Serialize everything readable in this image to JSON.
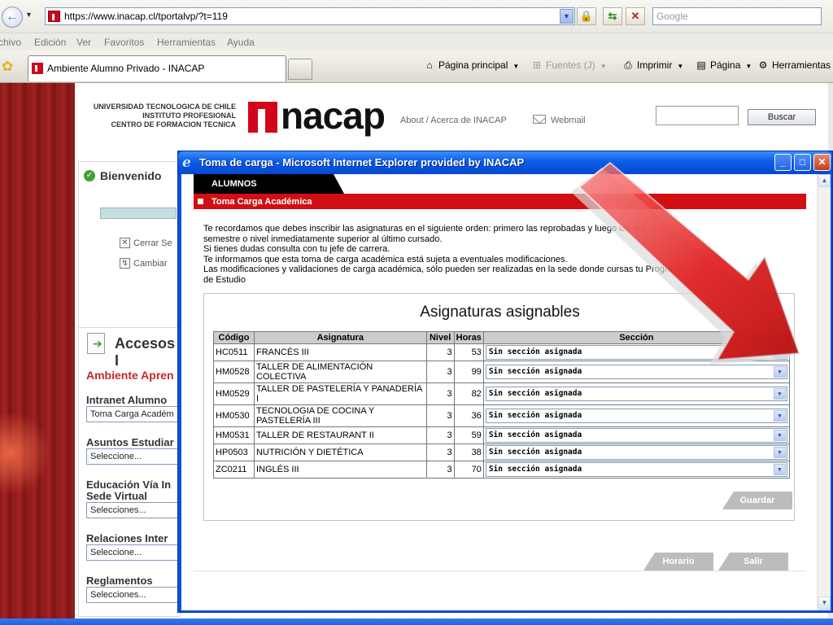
{
  "browser": {
    "url": "https://www.inacap.cl/tportalvp/?t=119",
    "search_placeholder": "Google",
    "menu": [
      "chivo",
      "Edición",
      "Ver",
      "Favoritos",
      "Herramientas",
      "Ayuda"
    ],
    "tab_title": "Ambiente Alumno Privado - INACAP",
    "commands": {
      "home": "Página principal",
      "feeds": "Fuentes (J)",
      "print": "Imprimir",
      "page": "Página",
      "tools": "Herramientas"
    }
  },
  "site": {
    "university_lines": [
      "UNIVERSIDAD TECNOLOGICA DE CHILE",
      "INSTITUTO PROFESIONAL",
      "CENTRO DE FORMACION TECNICA"
    ],
    "logo_text": "nacap",
    "about_link": "About / Acerca de INACAP",
    "webmail_link": "Webmail",
    "search_button": "Buscar",
    "welcome": {
      "title": "Bienvenido",
      "links": [
        "Cerrar Se",
        "Cambiar"
      ]
    },
    "accesos": {
      "title": "Accesos I",
      "ambiente": "Ambiente Apren",
      "sections": [
        {
          "label": "Intranet Alumno",
          "select": "Toma Carga Académ"
        },
        {
          "label": "Asuntos Estudiar",
          "select": "Seleccione..."
        },
        {
          "label": "Educación Vía In\nSede Virtual",
          "select": "Selecciones..."
        },
        {
          "label": "Relaciones Inter",
          "select": "Seleccione..."
        },
        {
          "label": "Reglamentos",
          "select": "Selecciones..."
        }
      ]
    }
  },
  "popup": {
    "title": "Toma de carga - Microsoft Internet Explorer provided by INACAP",
    "tab_label": "ALUMNOS",
    "section_label": "Toma Carga Académica",
    "instructions": [
      "Te recordamos que debes inscribir las asignaturas en el siguiente orden: primero las reprobadas y luego las del",
      "semestre o nivel inmediatamente superior al último cursado.",
      "Si tienes dudas consulta con tu jefe de carrera.",
      "Te informamos que esta toma de carga académica está sujeta a eventuales modificaciones.",
      "Las modificaciones y validaciones de carga académica, sólo pueden ser realizadas en la sede donde cursas tu Programa",
      "de Estudio"
    ],
    "table": {
      "title": "Asignaturas asignables",
      "headers": [
        "Código",
        "Asignatura",
        "Nivel",
        "Horas",
        "Sección"
      ],
      "rows": [
        {
          "code": "HC0511",
          "asignatura": "FRANCÉS III",
          "nivel": "3",
          "horas": "53",
          "seccion": "Sin sección asignada"
        },
        {
          "code": "HM0528",
          "asignatura": "TALLER DE ALIMENTACIÓN COLECTIVA",
          "nivel": "3",
          "horas": "99",
          "seccion": "Sin sección asignada"
        },
        {
          "code": "HM0529",
          "asignatura": "TALLER DE PASTELERÍA Y PANADERÍA I",
          "nivel": "3",
          "horas": "82",
          "seccion": "Sin sección asignada"
        },
        {
          "code": "HM0530",
          "asignatura": "TECNOLOGIA DE COCINA Y PASTELERÍA III",
          "nivel": "3",
          "horas": "36",
          "seccion": "Sin sección asignada"
        },
        {
          "code": "HM0531",
          "asignatura": "TALLER DE RESTAURANT II",
          "nivel": "3",
          "horas": "59",
          "seccion": "Sin sección asignada"
        },
        {
          "code": "HP0503",
          "asignatura": "NUTRICIÓN Y DIETÉTICA",
          "nivel": "3",
          "horas": "38",
          "seccion": "Sin sección asignada"
        },
        {
          "code": "ZC0211",
          "asignatura": "INGLÉS III",
          "nivel": "3",
          "horas": "70",
          "seccion": "Sin sección asignada"
        }
      ]
    },
    "buttons": {
      "guardar": "Guardar",
      "horario": "Horario",
      "salir": "Salir"
    }
  },
  "colors": {
    "brand_red": "#d10f12",
    "title_blue": "#0a5ce6",
    "button_grey": "#bcbcbc"
  }
}
